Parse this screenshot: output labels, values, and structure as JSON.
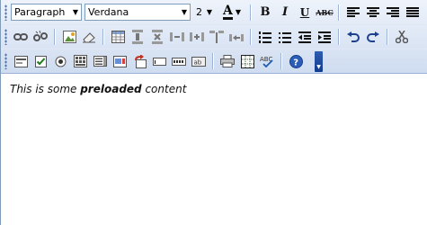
{
  "toolbar": {
    "format_select": {
      "value": "Paragraph"
    },
    "font_select": {
      "value": "Verdana"
    },
    "size_select": {
      "value": "2"
    },
    "font_color_label": "A",
    "bold_label": "B",
    "italic_label": "I",
    "underline_label": "U",
    "strike_label": "ABC"
  },
  "editor": {
    "content_prefix": "This is some ",
    "content_bold": "preloaded",
    "content_suffix": " content"
  }
}
